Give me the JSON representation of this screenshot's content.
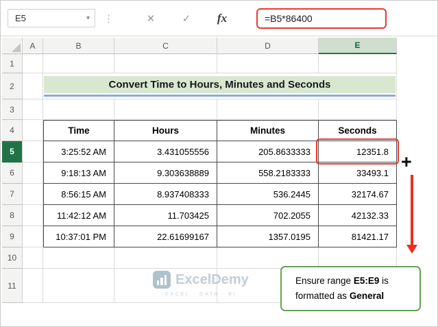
{
  "formula_bar": {
    "name_box_value": "E5",
    "fx_label": "fx",
    "formula": "=B5*86400"
  },
  "icons": {
    "name_box_dropdown": "▾",
    "separator_dots": "⋮",
    "cancel": "✕",
    "enter": "✓",
    "fill_handle_plus": "+"
  },
  "sheet": {
    "active_cell": "E5",
    "columns": [
      "A",
      "B",
      "C",
      "D",
      "E"
    ],
    "rows": [
      "1",
      "2",
      "3",
      "4",
      "5",
      "6",
      "7",
      "8",
      "9",
      "10",
      "11"
    ]
  },
  "title_banner": {
    "text": "Convert Time to Hours, Minutes and Seconds"
  },
  "data_table": {
    "headers": [
      "Time",
      "Hours",
      "Minutes",
      "Seconds"
    ],
    "rows": [
      {
        "time": "3:25:52 AM",
        "hours": "3.431055556",
        "minutes": "205.8633333",
        "seconds": "12351.8"
      },
      {
        "time": "9:18:13 AM",
        "hours": "9.303638889",
        "minutes": "558.2183333",
        "seconds": "33493.1"
      },
      {
        "time": "8:56:15 AM",
        "hours": "8.937408333",
        "minutes": "536.2445",
        "seconds": "32174.67"
      },
      {
        "time": "11:42:12 AM",
        "hours": "11.703425",
        "minutes": "702.2055",
        "seconds": "42132.33"
      },
      {
        "time": "10:37:01 PM",
        "hours": "22.61699167",
        "minutes": "1357.0195",
        "seconds": "81421.17"
      }
    ]
  },
  "callout": {
    "prefix": "Ensure range",
    "range": "E5:E9",
    "middle": "is formatted as",
    "format_name": "General"
  },
  "watermark": {
    "brand": "ExcelDemy",
    "tagline": "EXCEL · DATA · BI"
  },
  "colors": {
    "annotation_red": "#e8392c",
    "callout_green": "#61a24f",
    "excel_green": "#217346",
    "title_fill": "#d8e8d0",
    "title_underline": "#8aabdc"
  }
}
